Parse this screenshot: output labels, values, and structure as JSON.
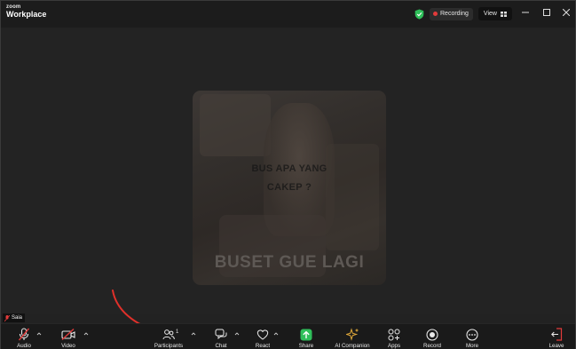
{
  "app": {
    "brand_top": "zoom",
    "brand_bottom": "Workplace"
  },
  "status": {
    "recording_label": "Recording",
    "view_label": "View"
  },
  "video": {
    "caption_top_line1": "BUS APA YANG",
    "caption_top_line2": "CAKEP ?",
    "caption_bottom": "BUSET GUE LAGI"
  },
  "participant": {
    "name": "Saia"
  },
  "toolbar": {
    "audio": "Audio",
    "video": "Video",
    "participants": "Participants",
    "participants_count": "1",
    "chat": "Chat",
    "react": "React",
    "share": "Share",
    "ai_companion": "AI Companion",
    "apps": "Apps",
    "record": "Record",
    "more": "More",
    "leave": "Leave"
  },
  "colors": {
    "background": "#222222",
    "recording_dot": "#e23b3b",
    "shield": "#2fbf5a",
    "share_green": "#2fbf5a",
    "muted_red": "#e23b3b",
    "ai_gold": "#e0a83a",
    "annotation_arrow": "#e0302a"
  }
}
